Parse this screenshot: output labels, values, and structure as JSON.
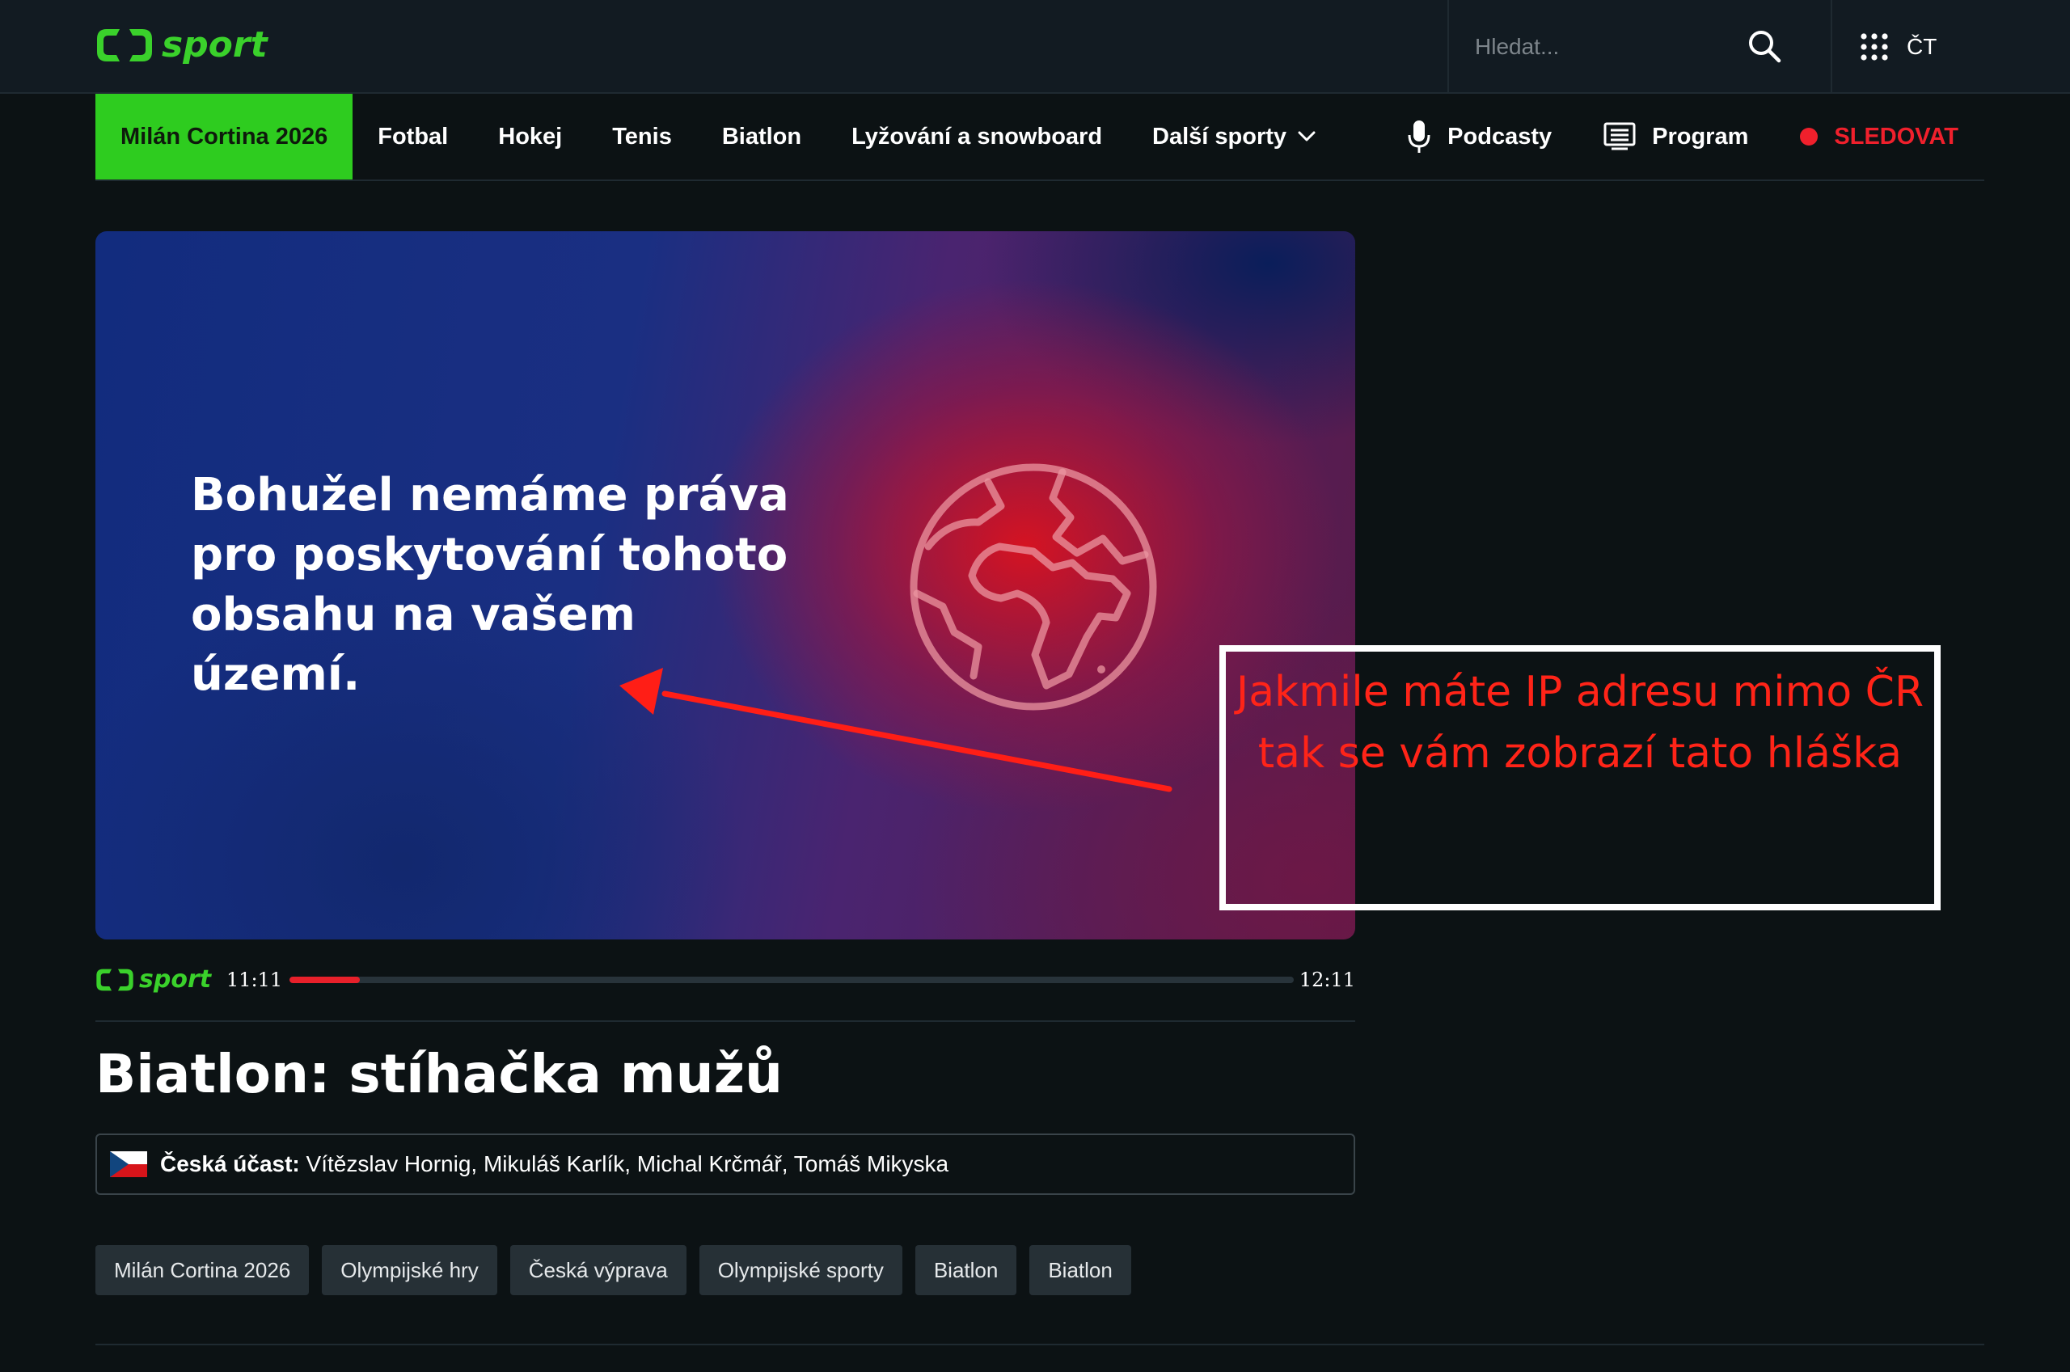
{
  "header": {
    "logo_text": "sport",
    "search_placeholder": "Hledat...",
    "apps_label": "ČT"
  },
  "nav": {
    "items": [
      {
        "label": "Milán Cortina 2026",
        "active": true
      },
      {
        "label": "Fotbal"
      },
      {
        "label": "Hokej"
      },
      {
        "label": "Tenis"
      },
      {
        "label": "Biatlon"
      },
      {
        "label": "Lyžování a snowboard"
      },
      {
        "label": "Další sporty"
      }
    ],
    "podcasts_label": "Podcasty",
    "program_label": "Program",
    "live_label": "SLEDOVAT"
  },
  "player": {
    "message": "Bohužel nemáme práva pro poskytování tohoto obsahu na vašem území."
  },
  "progress": {
    "logo_text": "sport",
    "start_time": "11:11",
    "end_time": "12:11",
    "fraction": 0.07
  },
  "article": {
    "title": "Biatlon: stíhačka mužů",
    "czech_label": "Česká účast:",
    "czech_names": "Vítězslav Hornig, Mikuláš Karlík, Michal Krčmář, Tomáš Mikyska"
  },
  "tags": [
    "Milán Cortina 2026",
    "Olympijské hry",
    "Česká výprava",
    "Olympijské sporty",
    "Biatlon",
    "Biatlon"
  ],
  "annotation": {
    "line1": "Jakmile máte IP adresu mimo ČR",
    "line2": "tak se vám zobrazí tato hláška"
  },
  "colors": {
    "brand_green": "#2ecc1f",
    "live_red": "#f0202c",
    "annotation_red": "#ff2418",
    "background": "#0c1214"
  }
}
